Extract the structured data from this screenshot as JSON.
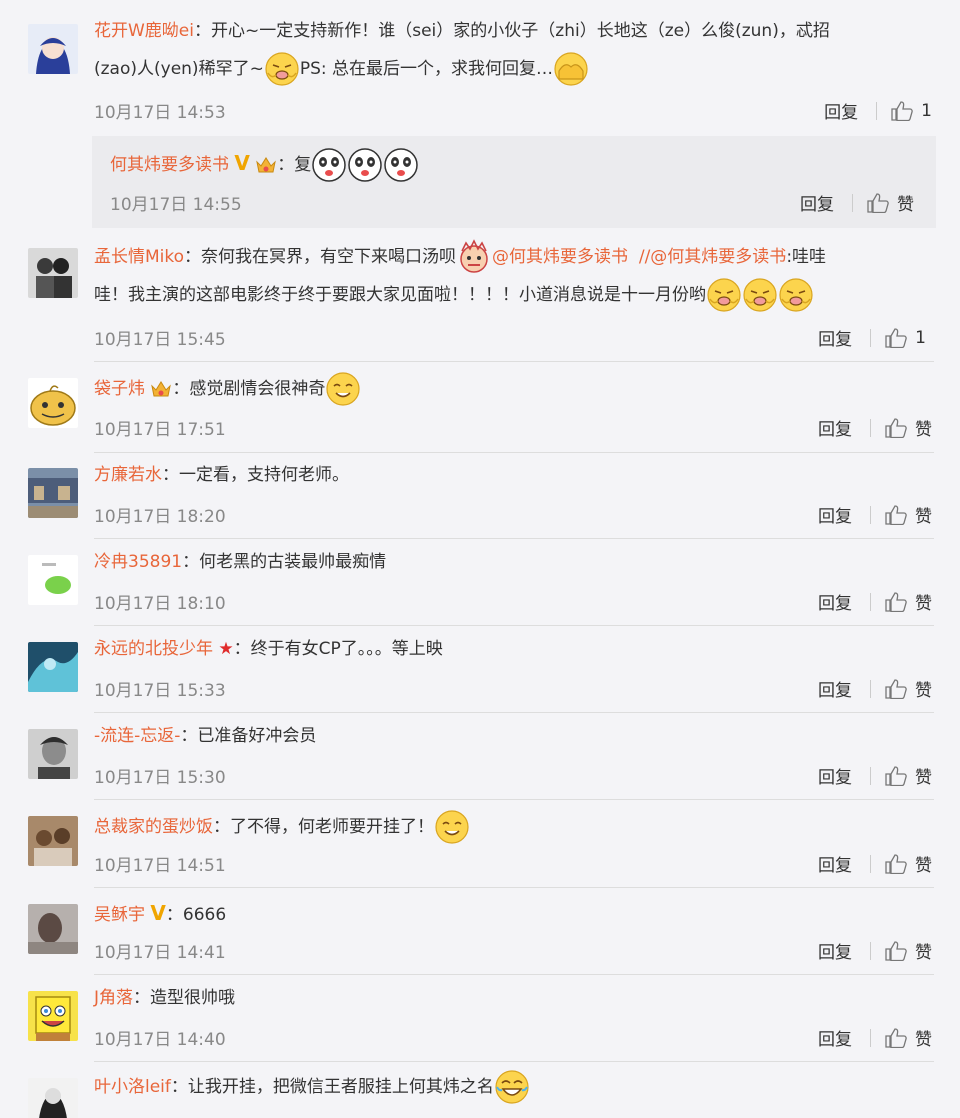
{
  "ui": {
    "reply_label": "回复",
    "like_label": "赞"
  },
  "comments": [
    {
      "user": "花开W鹿呦ei",
      "text1": "开心~一定支持新作！谁（sei）家的小伙子（zhi）长地这（ze）么俊(zun)，忒招",
      "text2": "(zao)人(yen)稀罕了~",
      "text3": "PS: 总在最后一个，求我何回复…",
      "time": "10月17日 14:53",
      "likes": "1",
      "sub": {
        "user": "何其炜要多读书",
        "text": "复",
        "time": "10月17日 14:55"
      }
    },
    {
      "user": "孟长情Miko",
      "text1": "奈何我在冥界，有空下来喝口汤呗",
      "mention1": "@何其炜要多读书",
      "mention2": "//@何其炜要多读书",
      "text2": ":哇哇",
      "text3": "哇！我主演的这部电影终于终于要跟大家见面啦！！！！小道消息说是十一月份哟",
      "time": "10月17日 15:45",
      "likes": "1"
    },
    {
      "user": "袋子炜",
      "text": "感觉剧情会很神奇",
      "time": "10月17日 17:51"
    },
    {
      "user": "方廉若水",
      "text": "一定看，支持何老师。",
      "time": "10月17日 18:20"
    },
    {
      "user": "冷冉35891",
      "text": "何老黑的古装最帅最痴情",
      "time": "10月17日 18:10"
    },
    {
      "user": "永远的北投少年",
      "text": "终于有女CP了。。。等上映",
      "time": "10月17日 15:33"
    },
    {
      "user": "-流连-忘返-",
      "text": "已准备好冲会员",
      "time": "10月17日 15:30"
    },
    {
      "user": "总裁家的蛋炒饭",
      "text": "了不得，何老师要开挂了！",
      "time": "10月17日 14:51"
    },
    {
      "user": "吴稣宇",
      "text": "6666",
      "time": "10月17日 14:41"
    },
    {
      "user": "J角落",
      "text": "造型很帅哦",
      "time": "10月17日 14:40"
    },
    {
      "user": "叶小洛leif",
      "text": "让我开挂，把微信王者服挂上何其炜之名"
    }
  ],
  "colors": {
    "username": "#e8663a",
    "vip_badge": "#f0a500",
    "background": "#f4f4f7"
  }
}
